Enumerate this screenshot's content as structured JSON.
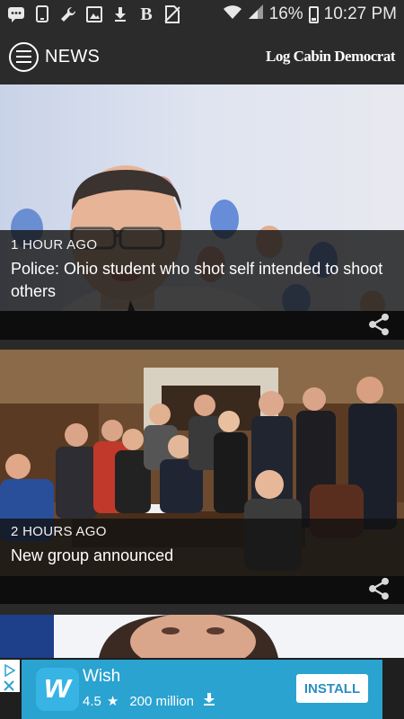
{
  "status_bar": {
    "battery": "16%",
    "time": "10:27 PM",
    "left_icons": [
      "message-icon",
      "tablet-icon",
      "wrench-icon",
      "image-icon",
      "download-icon",
      "newspaper-icon",
      "no-sim-icon"
    ]
  },
  "app_bar": {
    "section": "NEWS",
    "brand": "Log Cabin Democrat"
  },
  "articles": [
    {
      "time": "1 HOUR AGO",
      "headline": "Police: Ohio student who shot self intended to shoot others"
    },
    {
      "time": "2 HOURS AGO",
      "headline": "New group announced"
    }
  ],
  "ad": {
    "app_name": "Wish",
    "rating": "4.5",
    "downloads": "200 million",
    "install_label": "INSTALL",
    "logo_letter": "w"
  },
  "colors": {
    "ad_background": "#2aa3d1",
    "install_text": "#2a8fc0",
    "bar_background": "#2b2b2b"
  }
}
